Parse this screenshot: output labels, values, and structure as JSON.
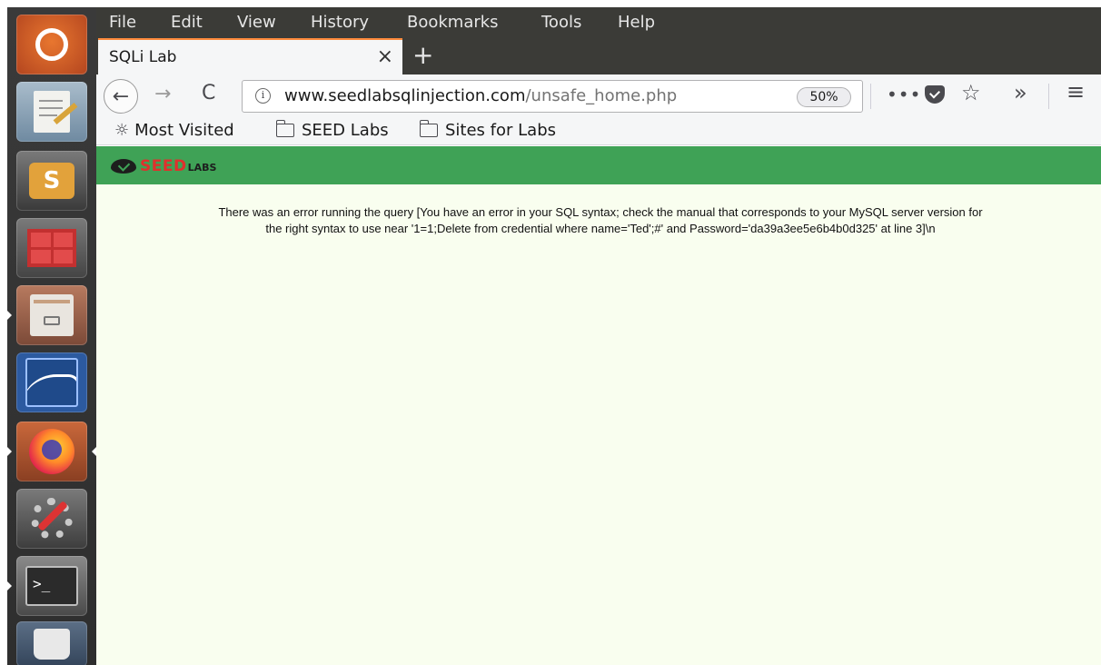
{
  "launcher": {
    "items": [
      {
        "name": "ubuntu-dash",
        "color": "#d85c2a"
      },
      {
        "name": "text-editor",
        "color": "#8fa9bf"
      },
      {
        "name": "sublime-text",
        "color": "#6a6a6a"
      },
      {
        "name": "calculator",
        "color": "#b52b2b"
      },
      {
        "name": "file-manager",
        "color": "#a76b54"
      },
      {
        "name": "wireshark",
        "color": "#2f5d9c"
      },
      {
        "name": "firefox",
        "color": "#ff7139"
      },
      {
        "name": "system-settings",
        "color": "#6a6a6a"
      },
      {
        "name": "terminal",
        "color": "#2b2b2b"
      },
      {
        "name": "trash",
        "color": "#4b5d73"
      }
    ]
  },
  "menubar": {
    "file": "File",
    "edit": "Edit",
    "view": "View",
    "history": "History",
    "bookmarks": "Bookmarks",
    "tools": "Tools",
    "help": "Help"
  },
  "tab": {
    "title": "SQLi Lab",
    "close_icon": "×",
    "new_tab_icon": "+"
  },
  "navbar": {
    "back_icon": "←",
    "forward_icon": "→",
    "reload_icon": "C",
    "url_domain": "www.seedlabsqlinjection.com",
    "url_path": "/unsafe_home.php",
    "zoom": "50%",
    "more_icon": "•••",
    "star_icon": "☆",
    "overflow_icon": "»",
    "menu_icon": "≡"
  },
  "bookmarks": {
    "most_visited": "Most Visited",
    "seed_labs": "SEED Labs",
    "sites_for_labs": "Sites for Labs"
  },
  "header": {
    "logo_word": "SEED",
    "logo_suffix": "LABS",
    "accent": "#3fa256"
  },
  "page": {
    "error_message": "There was an error running the query [You have an error in your SQL syntax; check the manual that corresponds to your MySQL server version for the right syntax to use near '1=1;Delete from credential where name='Ted';#' and Password='da39a3ee5e6b4b0d325' at line 3]\\n"
  }
}
